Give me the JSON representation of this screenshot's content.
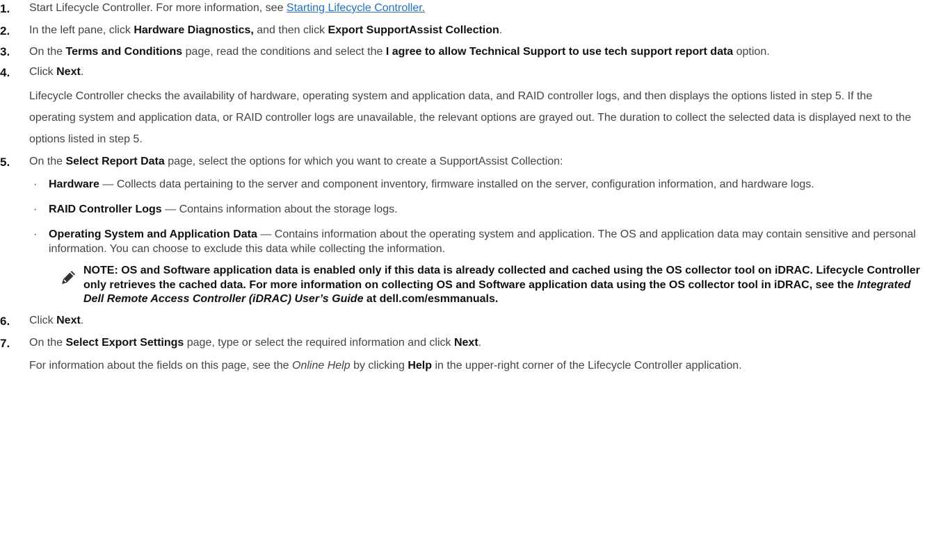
{
  "steps": [
    {
      "num": "1.",
      "text": "Start Lifecycle Controller. For more information, see ",
      "link": "Starting Lifecycle Controller."
    },
    {
      "num": "2.",
      "t1": "In the left pane, click ",
      "b1": "Hardware Diagnostics,",
      "t2": " and then click ",
      "b2": "Export SupportAssist Collection",
      "t3": "."
    },
    {
      "num": "3.",
      "t1": "On the ",
      "b1": "Terms and Conditions",
      "t2": " page, read the conditions and select the ",
      "b2": "I agree to allow Technical Support to use tech support report data",
      "t3": " option."
    },
    {
      "num": "4.",
      "t1": "Click ",
      "b1": "Next",
      "t2": ".",
      "para": "Lifecycle Controller checks the availability of hardware, operating system and application data, and RAID controller logs, and then displays the options listed in step 5. If the operating system and application data, or RAID controller logs are unavailable, the relevant options are grayed out. The duration to collect the selected data is displayed next to the options listed in step 5."
    },
    {
      "num": "5.",
      "t1": "On the ",
      "b1": "Select Report Data",
      "t2": " page, select the options for which you want to create a SupportAssist Collection:"
    },
    {
      "num": "6.",
      "t1": "Click ",
      "b1": "Next",
      "t2": "."
    },
    {
      "num": "7.",
      "t1": "On the ",
      "b1": "Select Export Settings",
      "t2": " page, type or select the required information and click ",
      "b2": "Next",
      "t3": ".",
      "para_t1": "For information about the fields on this page, see the ",
      "para_i1": "Online Help",
      "para_t2": " by clicking ",
      "para_b1": "Help",
      "para_t3": " in the upper-right corner of the Lifecycle Controller application."
    }
  ],
  "bullets": [
    {
      "term": "Hardware",
      "desc": " — Collects data pertaining to the server and component inventory, firmware installed on the server, configuration information, and hardware logs."
    },
    {
      "term": "RAID Controller Logs",
      "desc": " — Contains information about the storage logs."
    },
    {
      "term": "Operating System and Application Data",
      "desc": " — Contains information about the operating system and application. The OS and application data may contain sensitive and personal information. You can choose to exclude this data while collecting the information."
    }
  ],
  "note": {
    "t1": "NOTE: OS and Software application data is enabled only if this data is already collected and cached using the OS collector tool on iDRAC. Lifecycle Controller only retrieves the cached data. For more information on collecting OS and Software application data using the OS collector tool in iDRAC, see the ",
    "i1": "Integrated Dell Remote Access Controller (iDRAC) User’s Guide",
    "t2": " at dell.com/esmmanuals.",
    "icon": "pencil-icon"
  }
}
